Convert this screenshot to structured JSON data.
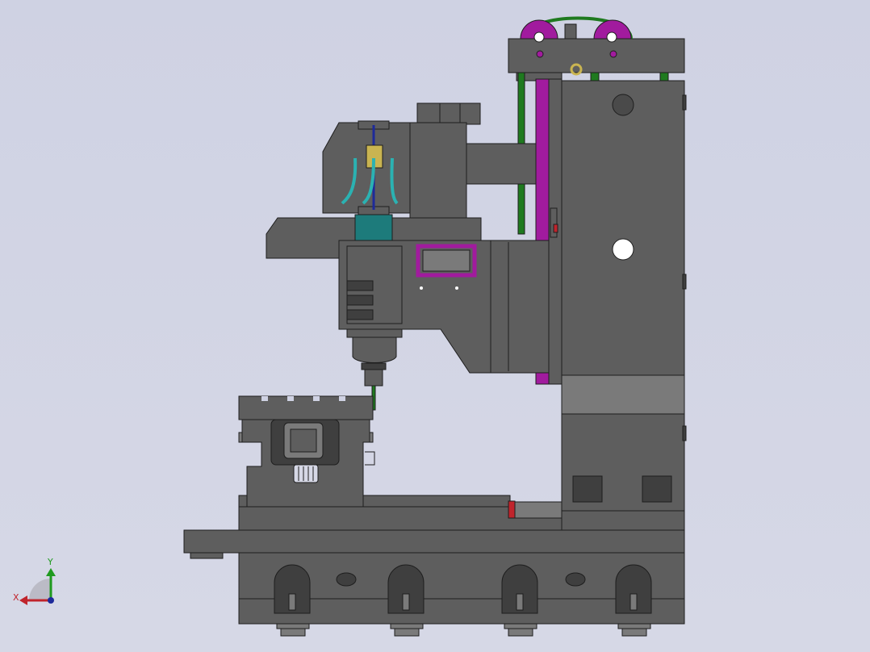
{
  "app": {
    "kind": "cad-3d-viewport",
    "view": "front"
  },
  "colors": {
    "background": "#d3d5e5",
    "body_gray": "#5e5e5e",
    "body_dark": "#3a3a3a",
    "edge": "#1e1e1e",
    "light_band": "#7a7a7a",
    "accent_magenta": "#a11b9e",
    "accent_green": "#1f7a1f",
    "accent_teal": "#1d7b7b",
    "accent_cyan": "#2bb2b2",
    "accent_yellow": "#c9b451",
    "accent_red": "#c0242c",
    "accent_blue": "#1e2a9a"
  },
  "triad": {
    "x_label": "X",
    "y_label": "Y",
    "x_color": "#c0242c",
    "y_color": "#1f9a1f",
    "z_color": "#1e2a9a"
  },
  "icons": {
    "triad": "coordinate-triad-icon"
  }
}
